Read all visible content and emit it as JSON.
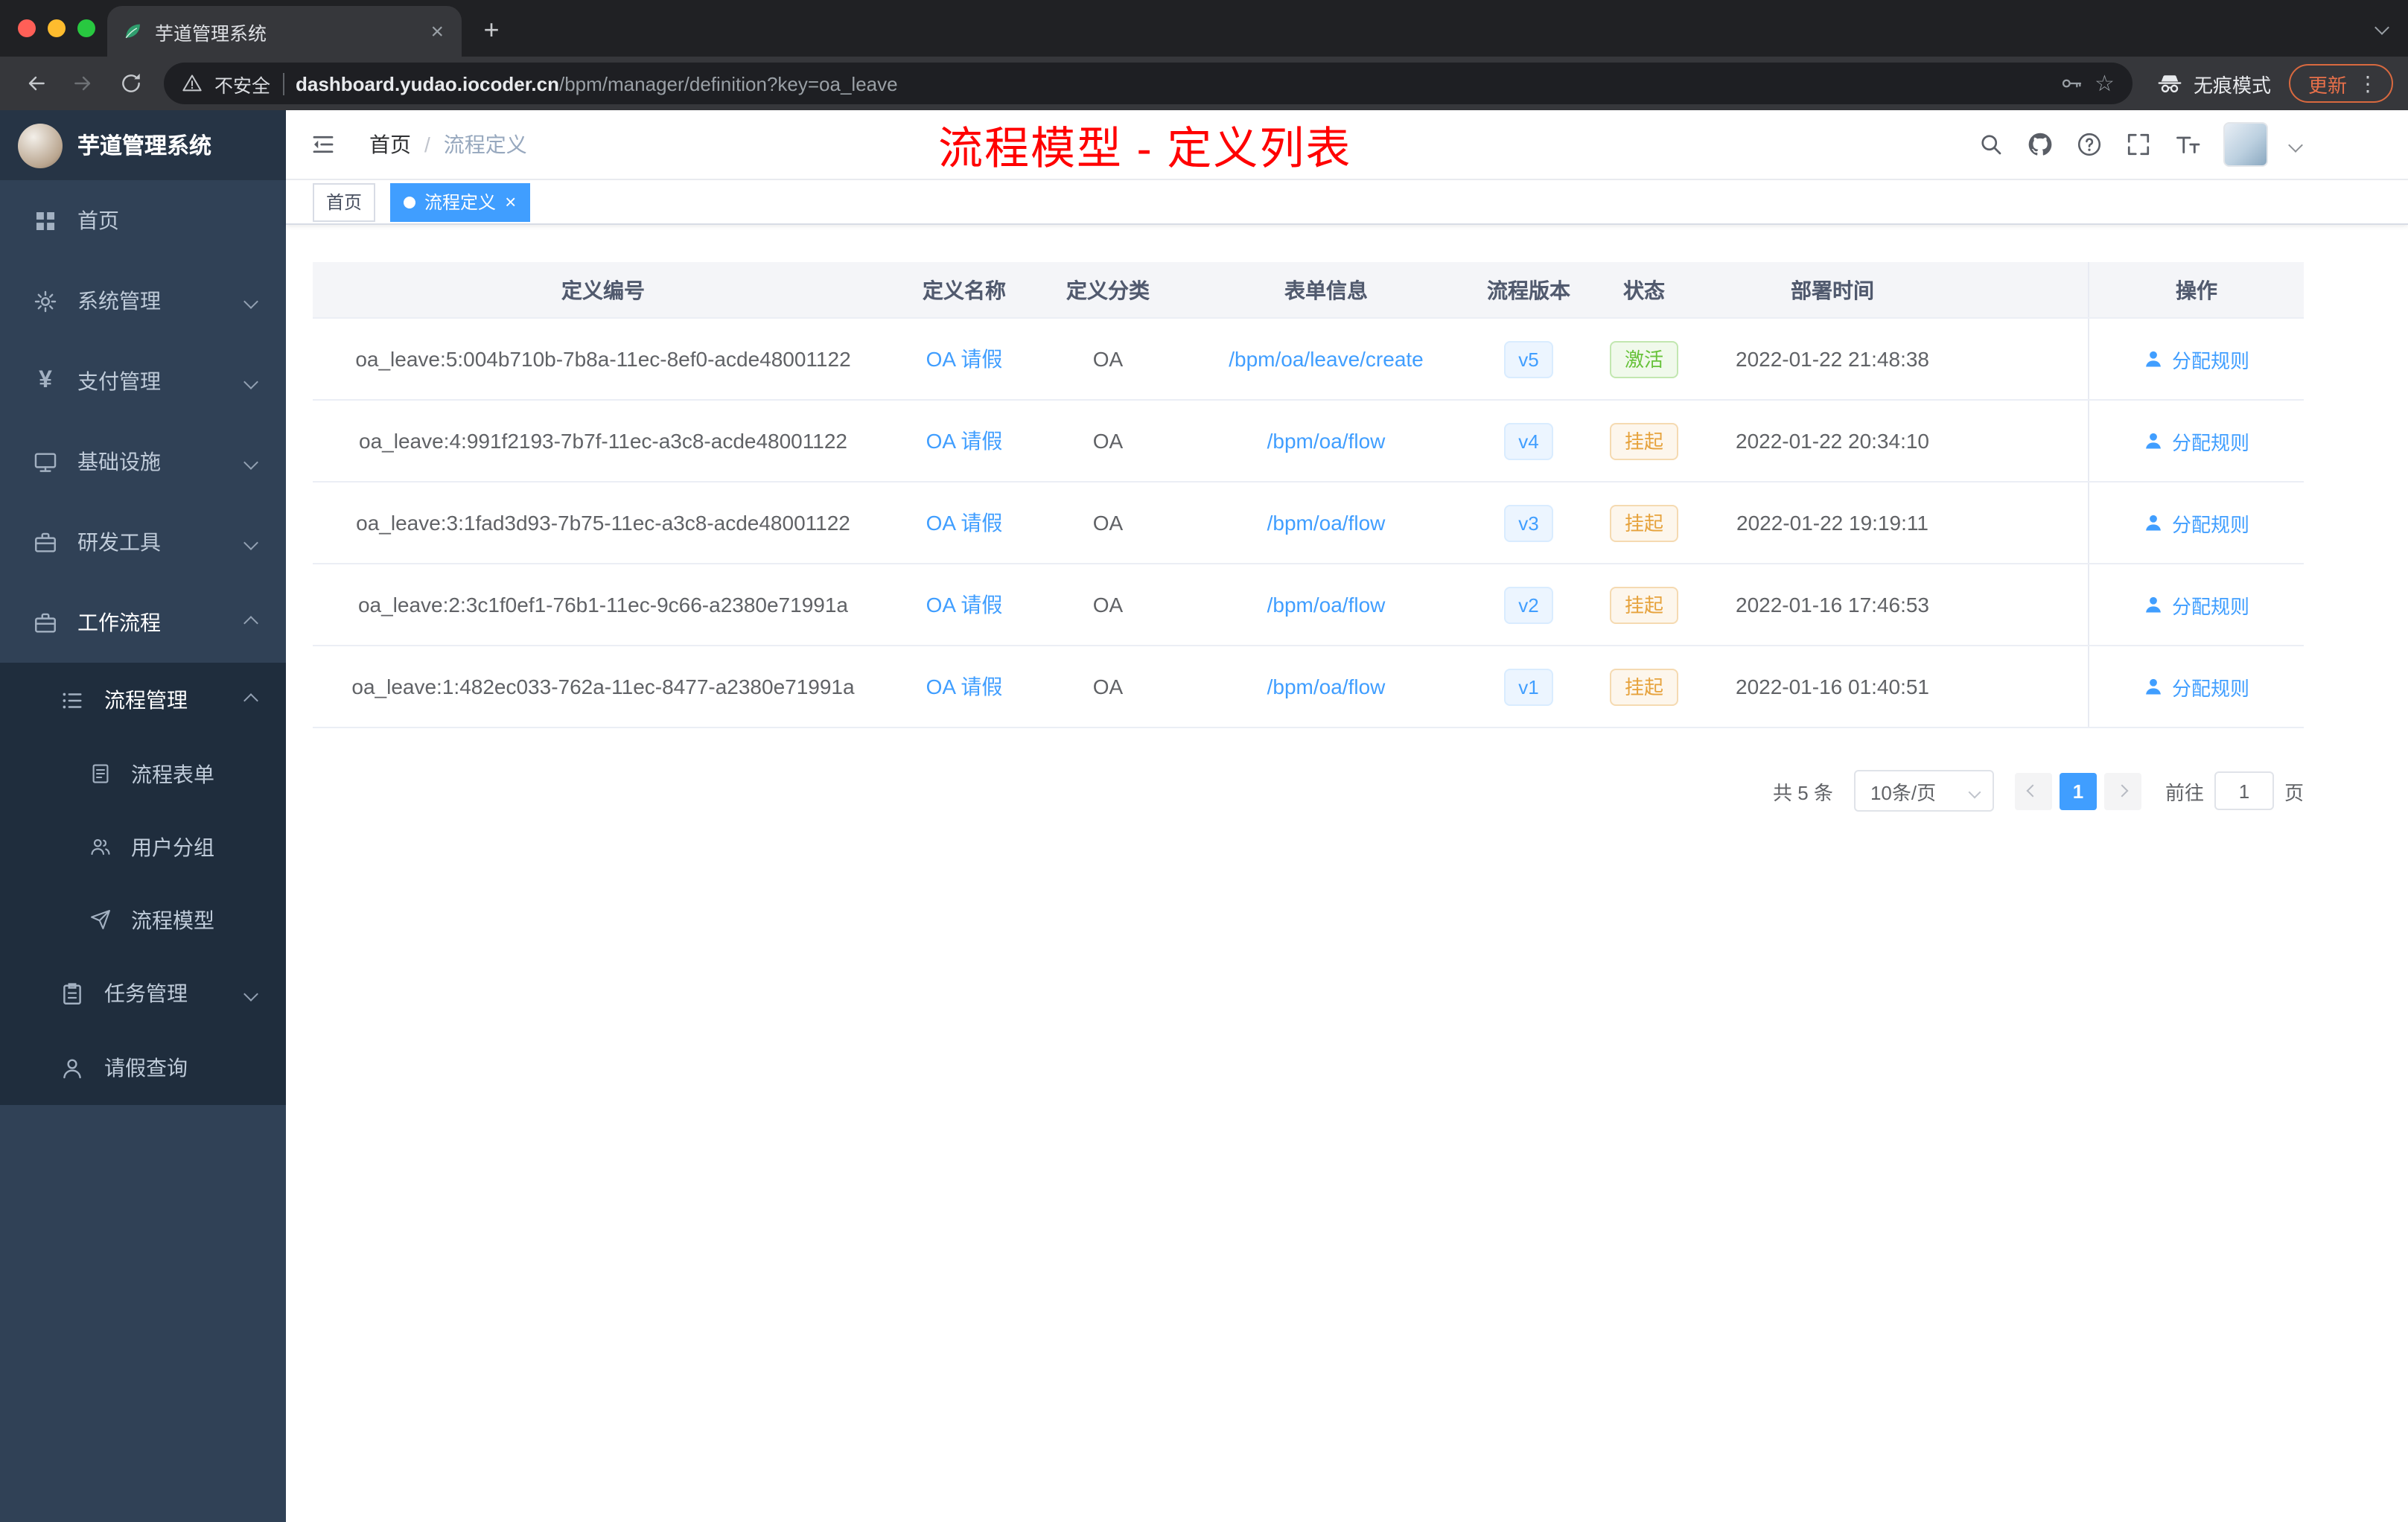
{
  "browser": {
    "tab_title": "芋道管理系统",
    "new_tab_label": "+",
    "security_label": "不安全",
    "url_domain": "dashboard.yudao.iocoder.cn",
    "url_path": "/bpm/manager/definition?key=oa_leave",
    "incognito_label": "无痕模式",
    "update_label": "更新"
  },
  "sidebar": {
    "logo_title": "芋道管理系统",
    "items": [
      {
        "label": "首页"
      },
      {
        "label": "系统管理"
      },
      {
        "label": "支付管理"
      },
      {
        "label": "基础设施"
      },
      {
        "label": "研发工具"
      },
      {
        "label": "工作流程"
      },
      {
        "label": "流程管理"
      },
      {
        "label": "流程表单"
      },
      {
        "label": "用户分组"
      },
      {
        "label": "流程模型"
      },
      {
        "label": "任务管理"
      },
      {
        "label": "请假查询"
      }
    ]
  },
  "header": {
    "breadcrumb": [
      "首页",
      "流程定义"
    ],
    "annotation": "流程模型 - 定义列表"
  },
  "tags": [
    {
      "label": "首页",
      "active": false
    },
    {
      "label": "流程定义",
      "active": true
    }
  ],
  "table": {
    "columns": [
      "定义编号",
      "定义名称",
      "定义分类",
      "表单信息",
      "流程版本",
      "状态",
      "部署时间",
      "操作"
    ],
    "rows": [
      {
        "id": "oa_leave:5:004b710b-7b8a-11ec-8ef0-acde48001122",
        "name": "OA 请假",
        "category": "OA",
        "form": "/bpm/oa/leave/create",
        "version": "v5",
        "status": "激活",
        "time": "2022-01-22 21:48:38",
        "action": "分配规则"
      },
      {
        "id": "oa_leave:4:991f2193-7b7f-11ec-a3c8-acde48001122",
        "name": "OA 请假",
        "category": "OA",
        "form": "/bpm/oa/flow",
        "version": "v4",
        "status": "挂起",
        "time": "2022-01-22 20:34:10",
        "action": "分配规则"
      },
      {
        "id": "oa_leave:3:1fad3d93-7b75-11ec-a3c8-acde48001122",
        "name": "OA 请假",
        "category": "OA",
        "form": "/bpm/oa/flow",
        "version": "v3",
        "status": "挂起",
        "time": "2022-01-22 19:19:11",
        "action": "分配规则"
      },
      {
        "id": "oa_leave:2:3c1f0ef1-76b1-11ec-9c66-a2380e71991a",
        "name": "OA 请假",
        "category": "OA",
        "form": "/bpm/oa/flow",
        "version": "v2",
        "status": "挂起",
        "time": "2022-01-16 17:46:53",
        "action": "分配规则"
      },
      {
        "id": "oa_leave:1:482ec033-762a-11ec-8477-a2380e71991a",
        "name": "OA 请假",
        "category": "OA",
        "form": "/bpm/oa/flow",
        "version": "v1",
        "status": "挂起",
        "time": "2022-01-16 01:40:51",
        "action": "分配规则"
      }
    ]
  },
  "pagination": {
    "total": "共 5 条",
    "page_size": "10条/页",
    "current_page": "1",
    "goto_label": "前往",
    "goto_value": "1",
    "page_unit": "页"
  },
  "colors": {
    "accent": "#409eff",
    "annotation_red": "#ff0000",
    "status_active_green": "#67c23a",
    "status_suspended_orange": "#e6a23c",
    "sidebar_bg": "#304156",
    "submenu_bg": "#1f2d3d"
  }
}
